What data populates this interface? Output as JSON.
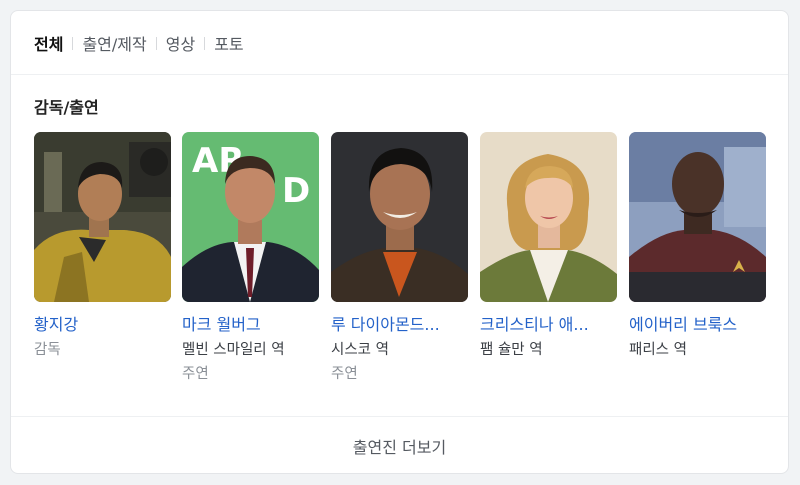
{
  "tabs": [
    {
      "label": "전체",
      "active": true
    },
    {
      "label": "출연/제작",
      "active": false
    },
    {
      "label": "영상",
      "active": false
    },
    {
      "label": "포토",
      "active": false
    }
  ],
  "section_title": "감독/출연",
  "people": [
    {
      "name": "황지강",
      "role": "",
      "meta": "감독"
    },
    {
      "name": "마크 월버그",
      "role": "멜빈 스마일리 역",
      "meta": "주연"
    },
    {
      "name": "루 다이아몬드...",
      "role": "시스코 역",
      "meta": "주연"
    },
    {
      "name": "크리스티나 애...",
      "role": "팸 슐만 역",
      "meta": ""
    },
    {
      "name": "에이버리 브룩스",
      "role": "패리스 역",
      "meta": ""
    }
  ],
  "more_label": "출연진 더보기",
  "colors": {
    "link": "#2462c9",
    "muted": "#8b9097"
  }
}
